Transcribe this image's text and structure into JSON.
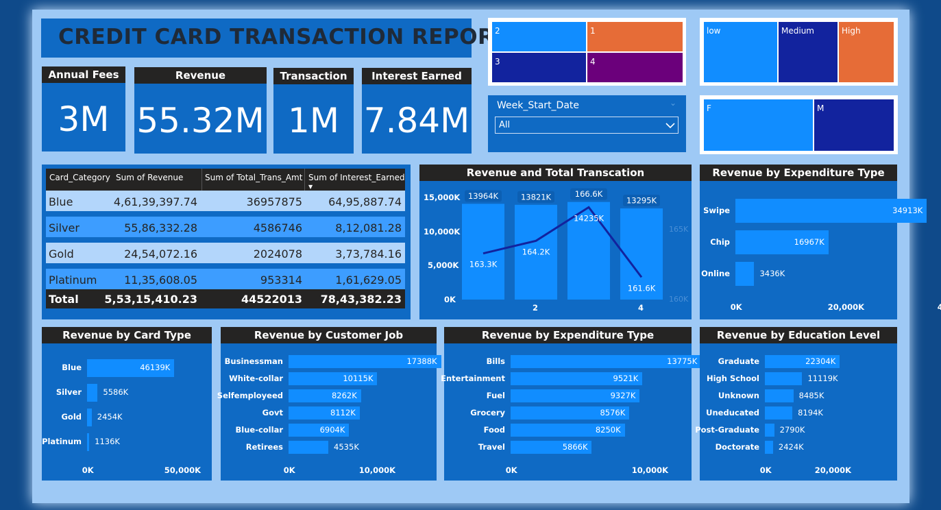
{
  "title": "CREDIT CARD TRANSACTION REPORT",
  "kpis": [
    {
      "label": "Annual Fees",
      "value": "3M"
    },
    {
      "label": "Revenue",
      "value": "55.32M"
    },
    {
      "label": "Transaction",
      "value": "1M"
    },
    {
      "label": "Interest Earned",
      "value": "7.84M"
    }
  ],
  "quarter_slicer": [
    {
      "label": "2",
      "color": "#118dff"
    },
    {
      "label": "1",
      "color": "#e66c37"
    },
    {
      "label": "3",
      "color": "#12239e"
    },
    {
      "label": "4",
      "color": "#6b007b"
    }
  ],
  "income_slicer": [
    {
      "label": "low",
      "color": "#118dff"
    },
    {
      "label": "Medium",
      "color": "#12239e"
    },
    {
      "label": "High",
      "color": "#e66c37"
    }
  ],
  "gender_slicer": [
    {
      "label": "F",
      "color": "#118dff"
    },
    {
      "label": "M",
      "color": "#12239e"
    }
  ],
  "week_slicer": {
    "title": "Week_Start_Date",
    "selected": "All"
  },
  "table": {
    "columns": [
      "Card_Category",
      "Sum of Revenue",
      "Sum of Total_Trans_Amt",
      "Sum of Interest_Earned"
    ],
    "rows": [
      [
        "Blue",
        "4,61,39,397.74",
        "36957875",
        "64,95,887.74"
      ],
      [
        "Silver",
        "55,86,332.28",
        "4586746",
        "8,12,081.28"
      ],
      [
        "Gold",
        "24,54,072.16",
        "2024078",
        "3,73,784.16"
      ],
      [
        "Platinum",
        "11,35,608.05",
        "953314",
        "1,61,629.05"
      ]
    ],
    "total": [
      "Total",
      "5,53,15,410.23",
      "44522013",
      "78,43,382.23"
    ]
  },
  "combo_chart": {
    "title": "Revenue and Total Transcation",
    "y_ticks": [
      "15,000K",
      "10,000K",
      "5,000K",
      "0K"
    ],
    "x_ticks": [
      "2",
      "4"
    ],
    "right_ticks": [
      "165K",
      "160K"
    ],
    "bar_labels": [
      "13964K",
      "13821K",
      "166.6K",
      "13295K"
    ],
    "line_labels": [
      "163.3K",
      "164.2K",
      "14235K",
      "161.6K"
    ]
  },
  "chart_data": [
    {
      "type": "bar",
      "title": "Revenue and Total Transcation",
      "categories": [
        "1",
        "2",
        "3",
        "4"
      ],
      "series": [
        {
          "name": "",
          "values": [
            13964,
            13821,
            14235,
            13295
          ]
        },
        {
          "name": "",
          "values": [
            163.3,
            164.2,
            166.6,
            161.6
          ]
        }
      ],
      "ylim": [
        0,
        15000
      ]
    },
    {
      "type": "bar",
      "title": "Revenue by Expenditure Type",
      "categories": [
        "Swipe",
        "Chip",
        "Online"
      ],
      "values": [
        34913,
        16967,
        3436
      ],
      "labels": [
        "34913K",
        "16967K",
        "3436K"
      ],
      "x_ticks": [
        "0K",
        "20,000K",
        "40,000K"
      ],
      "xlim": [
        0,
        50000
      ]
    },
    {
      "type": "bar",
      "title": "Revenue by Card Type",
      "categories": [
        "Blue",
        "Silver",
        "Gold",
        "Platinum"
      ],
      "values": [
        46139,
        5586,
        2454,
        1136
      ],
      "labels": [
        "46139K",
        "5586K",
        "2454K",
        "1136K"
      ],
      "x_ticks": [
        "0K",
        "50,000K"
      ],
      "xlim": [
        0,
        100000
      ]
    },
    {
      "type": "bar",
      "title": "Revenue by Customer Job",
      "categories": [
        "Businessman",
        "White-collar",
        "Selfemployeed",
        "Govt",
        "Blue-collar",
        "Retirees"
      ],
      "values": [
        17388,
        10115,
        8262,
        8112,
        6904,
        4535
      ],
      "labels": [
        "17388K",
        "10115K",
        "8262K",
        "8112K",
        "6904K",
        "4535K"
      ],
      "x_ticks": [
        "0K",
        "10,000K",
        "20,000K"
      ],
      "xlim": [
        0,
        30000
      ]
    },
    {
      "type": "bar",
      "title": "Revenue by Expenditure Type",
      "categories": [
        "Bills",
        "Entertainment",
        "Fuel",
        "Grocery",
        "Food",
        "Travel"
      ],
      "values": [
        13775,
        9521,
        9327,
        8576,
        8250,
        5866
      ],
      "labels": [
        "13775K",
        "9521K",
        "9327K",
        "8576K",
        "8250K",
        "5866K"
      ],
      "x_ticks": [
        "0K",
        "10,000K"
      ],
      "xlim": [
        0,
        20000
      ]
    },
    {
      "type": "bar",
      "title": "Revenue by Education Level",
      "categories": [
        "Graduate",
        "High School",
        "Unknown",
        "Uneducated",
        "Post-Graduate",
        "Doctorate"
      ],
      "values": [
        22304,
        11119,
        8485,
        8194,
        2790,
        2424
      ],
      "labels": [
        "22304K",
        "11119K",
        "8485K",
        "8194K",
        "2790K",
        "2424K"
      ],
      "x_ticks": [
        "0K",
        "20,000K"
      ],
      "xlim": [
        0,
        40000
      ]
    }
  ]
}
